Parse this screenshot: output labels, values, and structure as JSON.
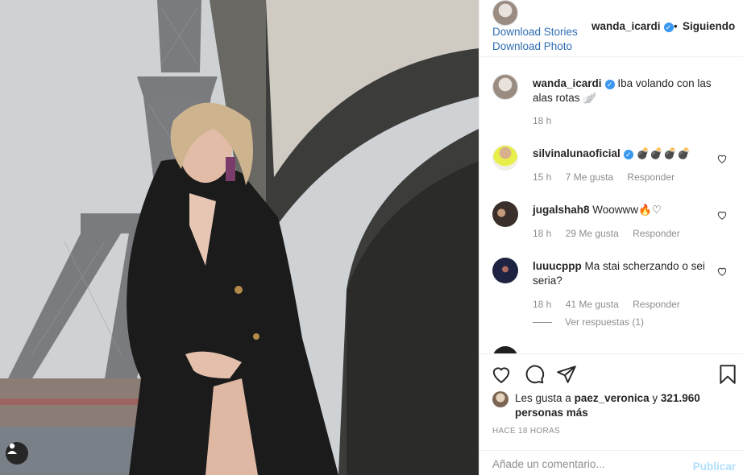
{
  "post_header": {
    "username": "wanda_icardi",
    "separator": "•",
    "follow_status": "Siguiendo",
    "download_stories": "Download Stories",
    "download_photo": "Download Photo"
  },
  "caption": {
    "username": "wanda_icardi",
    "text": "Iba volando con las alas rotas 🪽",
    "time": "18 h"
  },
  "comments": [
    {
      "username": "silvinalunaoficial",
      "verified": true,
      "text": "💣💣💣💣",
      "time": "15 h",
      "likes": "7 Me gusta",
      "reply": "Responder"
    },
    {
      "username": "jugalshah8",
      "verified": false,
      "text": "Woowww🔥♡",
      "time": "18 h",
      "likes": "29 Me gusta",
      "reply": "Responder"
    },
    {
      "username": "luuucppp",
      "verified": false,
      "text": "Ma stai scherzando o sei seria?",
      "time": "18 h",
      "likes": "41 Me gusta",
      "reply": "Responder",
      "view_replies": "Ver respuestas (1)"
    }
  ],
  "likes": {
    "prefix": "Les gusta a",
    "user": "paez_veronica",
    "conjunction": "y",
    "others": "321.960 personas más"
  },
  "timestamp": "HACE 18 HORAS",
  "add_comment": {
    "placeholder": "Añade un comentario...",
    "publish_label": "Publicar"
  },
  "colors": {
    "link": "#2e6db4",
    "verified": "#3897f0",
    "publish_disabled": "#b2dffc",
    "muted": "#8e8e8e"
  },
  "icons": [
    "heart-icon",
    "comment-icon",
    "share-icon",
    "bookmark-icon",
    "user-tag-icon",
    "verified-badge-icon"
  ]
}
